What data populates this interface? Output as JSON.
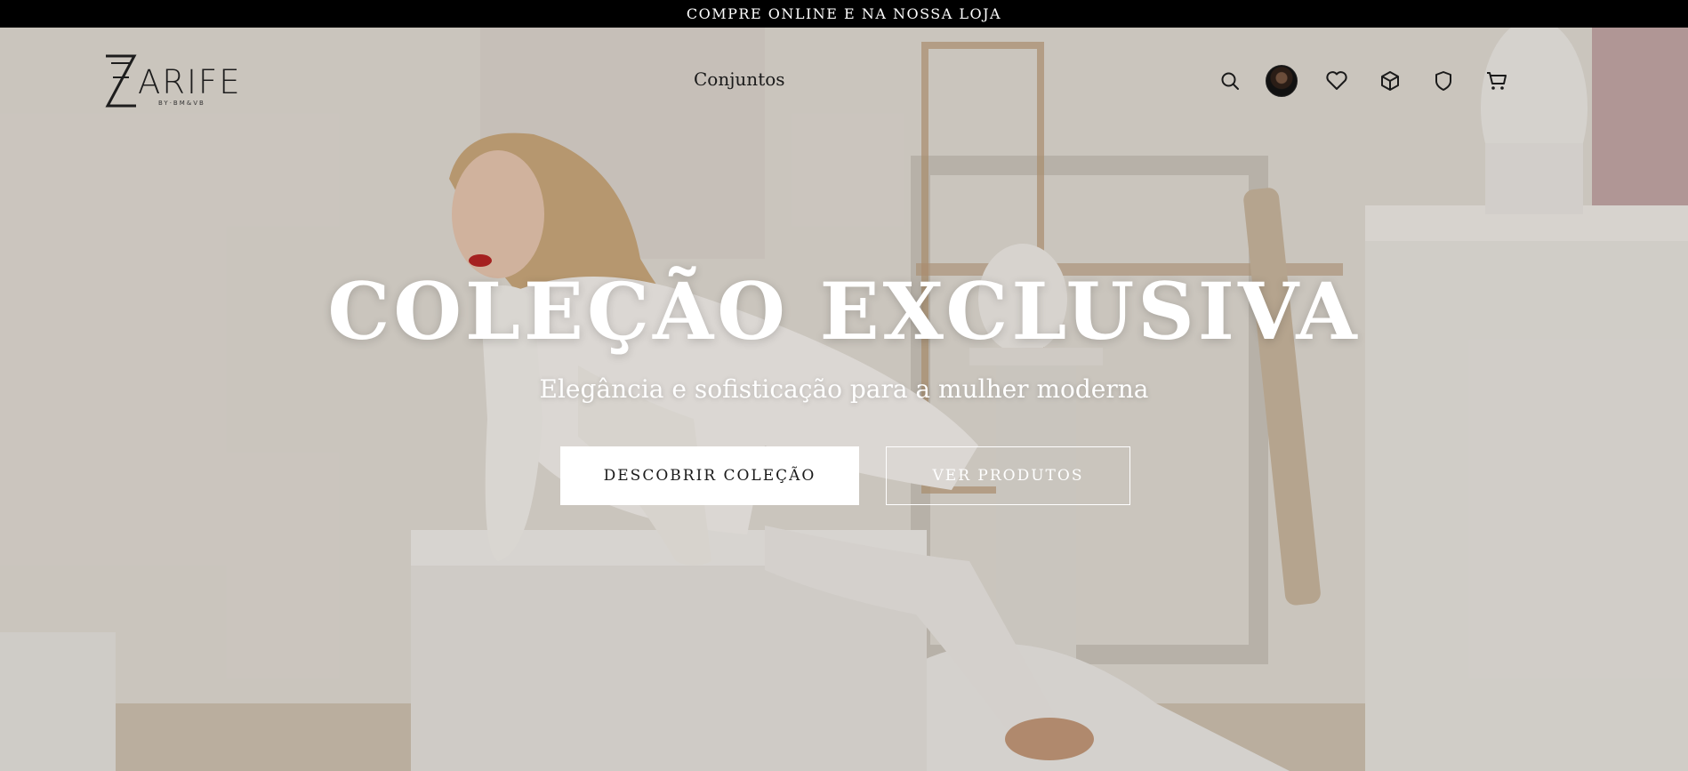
{
  "announcement": "COMPRE ONLINE E NA NOSSA LOJA",
  "brand": {
    "name": "ARIFE",
    "tagline": "BY·BM&VB"
  },
  "nav": {
    "links": [
      {
        "label": "Conjuntos"
      }
    ]
  },
  "header_icons": [
    "search-icon",
    "user-avatar",
    "heart-icon",
    "box-icon",
    "shield-icon",
    "cart-icon"
  ],
  "hero": {
    "title": "COLEÇÃO EXCLUSIVA",
    "subtitle": "Elegância e sofisticação para a mulher moderna",
    "primary_cta": "DESCOBRIR COLEÇÃO",
    "secondary_cta": "VER PRODUTOS"
  },
  "colors": {
    "topbar": "#000000",
    "text_dark": "#1a1a1a",
    "hero_text": "#ffffff"
  }
}
